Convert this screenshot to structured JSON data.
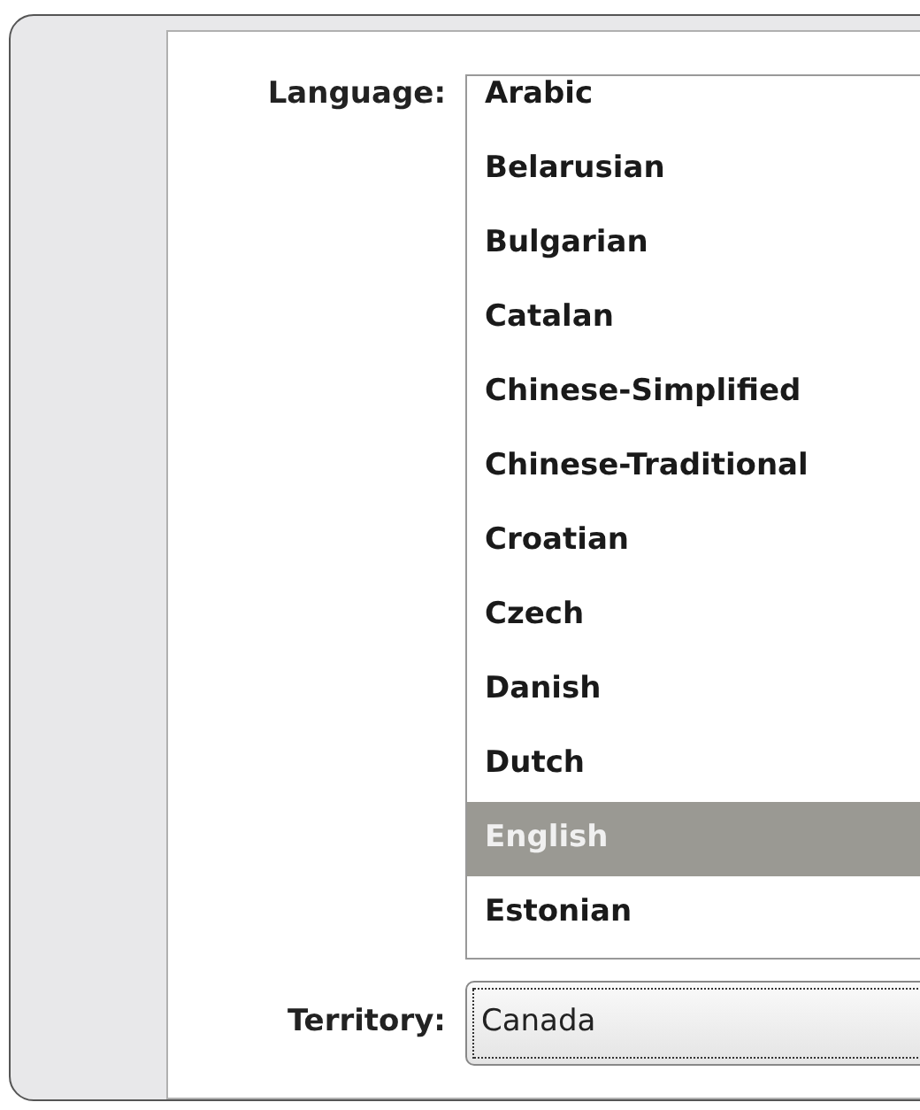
{
  "language": {
    "label": "Language:",
    "items": [
      {
        "label": "Arabic",
        "selected": false
      },
      {
        "label": "Belarusian",
        "selected": false
      },
      {
        "label": "Bulgarian",
        "selected": false
      },
      {
        "label": "Catalan",
        "selected": false
      },
      {
        "label": "Chinese-Simplified",
        "selected": false
      },
      {
        "label": "Chinese-Traditional",
        "selected": false
      },
      {
        "label": "Croatian",
        "selected": false
      },
      {
        "label": "Czech",
        "selected": false
      },
      {
        "label": "Danish",
        "selected": false
      },
      {
        "label": "Dutch",
        "selected": false
      },
      {
        "label": "English",
        "selected": true
      },
      {
        "label": "Estonian",
        "selected": false
      }
    ]
  },
  "territory": {
    "label": "Territory:",
    "value": "Canada"
  }
}
